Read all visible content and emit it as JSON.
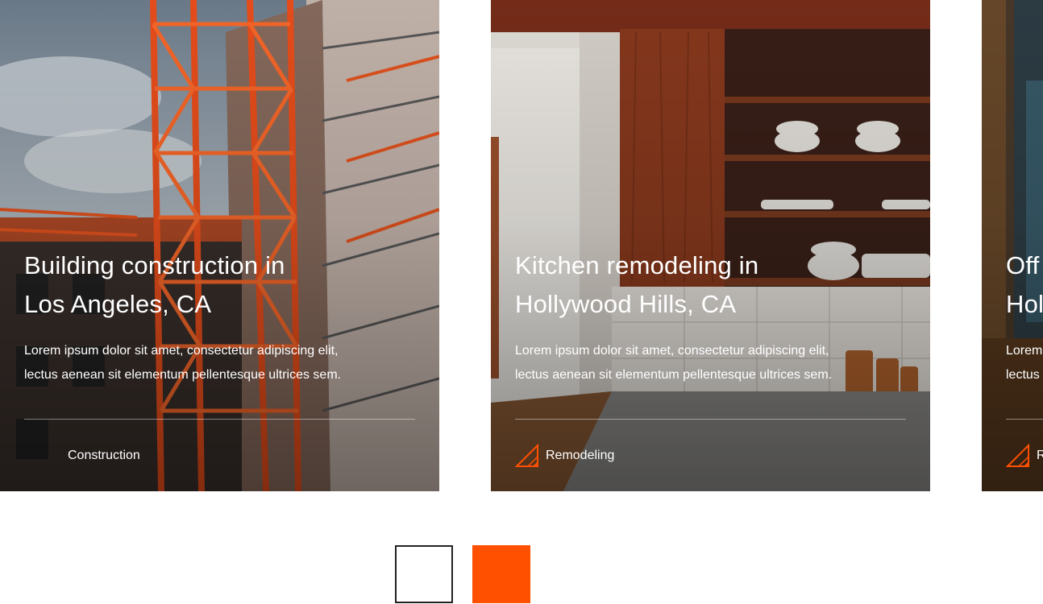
{
  "colors": {
    "accent": "#ff5000",
    "text": "#ffffff",
    "pager_border": "#222222"
  },
  "projects": [
    {
      "title_line1": "Building construction in",
      "title_line2": "Los Angeles, CA",
      "desc_line1": "Lorem ipsum dolor sit amet, consectetur adipiscing elit,",
      "desc_line2": "lectus aenean sit elementum pellentesque ultrices sem.",
      "category": "Construction",
      "category_icon": "triangle-ruler-icon"
    },
    {
      "title_line1": "Kitchen remodeling in",
      "title_line2": "Hollywood Hills, CA",
      "desc_line1": "Lorem ipsum dolor sit amet, consectetur adipiscing elit,",
      "desc_line2": "lectus aenean sit elementum pellentesque ultrices sem.",
      "category": "Remodeling",
      "category_icon": "triangle-ruler-icon"
    },
    {
      "title_line1": "Off",
      "title_line2": "Hol",
      "desc_line1": "Lorem",
      "desc_line2": "lectus",
      "category": "R",
      "category_icon": "triangle-ruler-icon"
    }
  ],
  "pager": {
    "prev_icon": "arrow-left-icon",
    "next_icon": "arrow-right-icon"
  }
}
